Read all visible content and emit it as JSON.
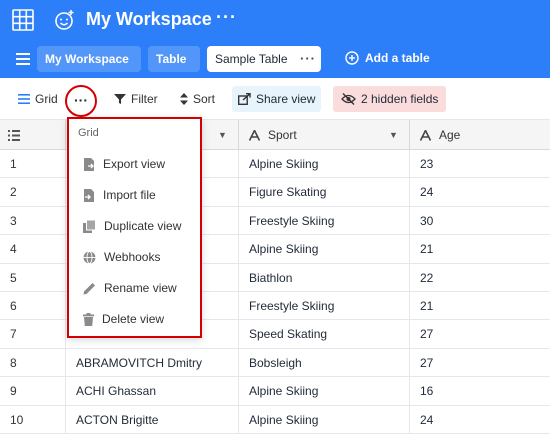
{
  "topbar": {
    "workspace_title": "My Workspace",
    "more": "···"
  },
  "tabs": {
    "workspace": "My Workspace",
    "table": "Table",
    "active": "Sample Table",
    "active_more": "···",
    "add_table": "Add a table"
  },
  "toolbar": {
    "grid": "Grid",
    "more": "···",
    "filter": "Filter",
    "sort": "Sort",
    "share": "Share view",
    "hidden": "2 hidden fields"
  },
  "headers": {
    "sport": "Sport",
    "age": "Age"
  },
  "menu": {
    "title": "Grid",
    "items": [
      {
        "label": "Export view",
        "icon": "export-icon"
      },
      {
        "label": "Import file",
        "icon": "import-icon"
      },
      {
        "label": "Duplicate view",
        "icon": "duplicate-icon"
      },
      {
        "label": "Webhooks",
        "icon": "webhooks-icon"
      },
      {
        "label": "Rename view",
        "icon": "pencil-icon"
      },
      {
        "label": "Delete view",
        "icon": "trash-icon"
      }
    ]
  },
  "rows": [
    {
      "num": "1",
      "name": "",
      "sport": "Alpine Skiing",
      "age": "23"
    },
    {
      "num": "2",
      "name": "",
      "sport": "Figure Skating",
      "age": "24"
    },
    {
      "num": "3",
      "name": "",
      "sport": "Freestyle Skiing",
      "age": "30"
    },
    {
      "num": "4",
      "name": "",
      "sport": "Alpine Skiing",
      "age": "21"
    },
    {
      "num": "5",
      "name": "",
      "sport": "Biathlon",
      "age": "22"
    },
    {
      "num": "6",
      "name": "",
      "sport": "Freestyle Skiing",
      "age": "21"
    },
    {
      "num": "7",
      "name": "",
      "sport": "Speed Skating",
      "age": "27"
    },
    {
      "num": "8",
      "name": "ABRAMOVITCH Dmitry",
      "sport": "Bobsleigh",
      "age": "27"
    },
    {
      "num": "9",
      "name": "ACHI Ghassan",
      "sport": "Alpine Skiing",
      "age": "16"
    },
    {
      "num": "10",
      "name": "ACTON Brigitte",
      "sport": "Alpine Skiing",
      "age": "24"
    }
  ],
  "colors": {
    "topbar": "#2d7ff9",
    "highlight_red": "#d40000",
    "share_bg": "#e8f4fc",
    "hidden_bg": "#fbdcdc"
  }
}
